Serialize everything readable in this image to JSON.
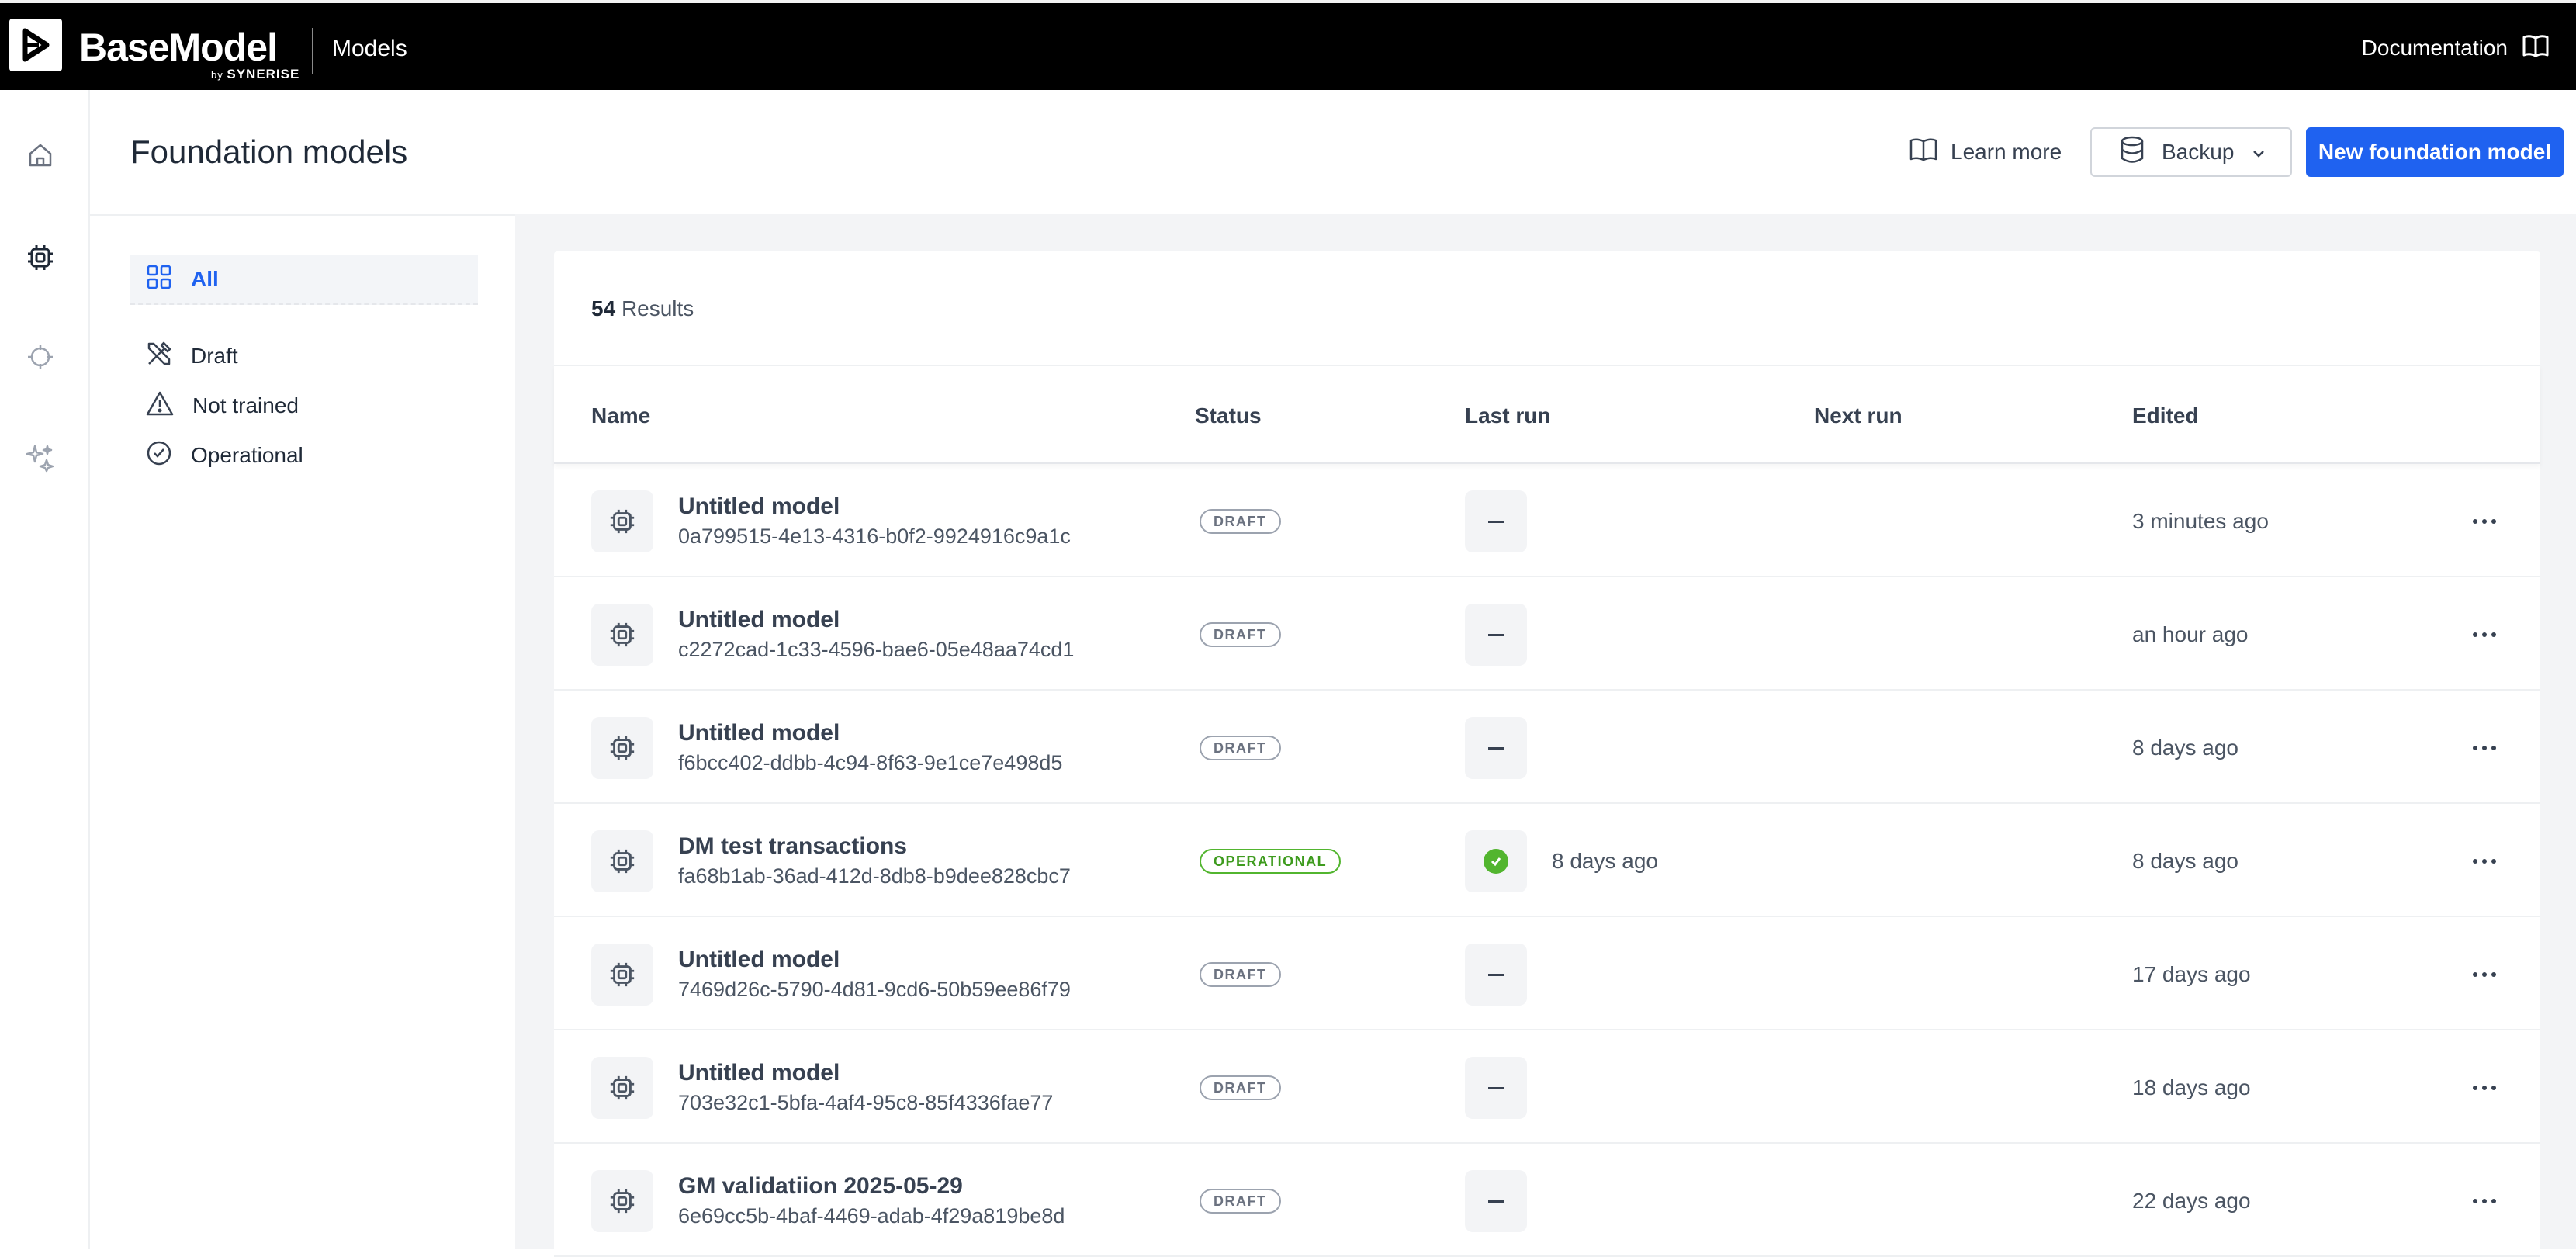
{
  "topbar": {
    "brand": "BaseModel",
    "brand_by": "by",
    "brand_company": "SYNERISE",
    "section": "Models",
    "documentation": "Documentation"
  },
  "rail": {
    "items": [
      {
        "icon": "home-icon"
      },
      {
        "icon": "chip-icon"
      },
      {
        "icon": "crosshair-icon"
      },
      {
        "icon": "sparkles-icon"
      }
    ]
  },
  "header": {
    "title": "Foundation models",
    "learn_more": "Learn more",
    "backup": "Backup",
    "new_model": "New foundation model"
  },
  "filters": [
    {
      "label": "All",
      "icon": "grid-icon",
      "active": true
    },
    {
      "label": "Draft",
      "icon": "tools-icon",
      "active": false
    },
    {
      "label": "Not trained",
      "icon": "warning-icon",
      "active": false
    },
    {
      "label": "Operational",
      "icon": "check-circle-icon",
      "active": false
    }
  ],
  "results": {
    "count": "54",
    "label": "Results"
  },
  "table": {
    "columns": {
      "name": "Name",
      "status": "Status",
      "last_run": "Last run",
      "next_run": "Next run",
      "edited": "Edited"
    },
    "rows": [
      {
        "name": "Untitled model",
        "id": "0a799515-4e13-4316-b0f2-9924916c9a1c",
        "status": "DRAFT",
        "last_run": "",
        "next_run": "",
        "edited": "3 minutes ago"
      },
      {
        "name": "Untitled model",
        "id": "c2272cad-1c33-4596-bae6-05e48aa74cd1",
        "status": "DRAFT",
        "last_run": "",
        "next_run": "",
        "edited": "an hour ago"
      },
      {
        "name": "Untitled model",
        "id": "f6bcc402-ddbb-4c94-8f63-9e1ce7e498d5",
        "status": "DRAFT",
        "last_run": "",
        "next_run": "",
        "edited": "8 days ago"
      },
      {
        "name": "DM test transactions",
        "id": "fa68b1ab-36ad-412d-8db8-b9dee828cbc7",
        "status": "OPERATIONAL",
        "last_run": "8 days ago",
        "next_run": "",
        "edited": "8 days ago"
      },
      {
        "name": "Untitled model",
        "id": "7469d26c-5790-4d81-9cd6-50b59ee86f79",
        "status": "DRAFT",
        "last_run": "",
        "next_run": "",
        "edited": "17 days ago"
      },
      {
        "name": "Untitled model",
        "id": "703e32c1-5bfa-4af4-95c8-85f4336fae77",
        "status": "DRAFT",
        "last_run": "",
        "next_run": "",
        "edited": "18 days ago"
      },
      {
        "name": "GM validatiion 2025-05-29",
        "id": "6e69cc5b-4baf-4469-adab-4f29a819be8d",
        "status": "DRAFT",
        "last_run": "",
        "next_run": "",
        "edited": "22 days ago"
      }
    ]
  },
  "colors": {
    "accent": "#1f62f0",
    "operational": "#52b52f",
    "topbar": "#000000"
  }
}
